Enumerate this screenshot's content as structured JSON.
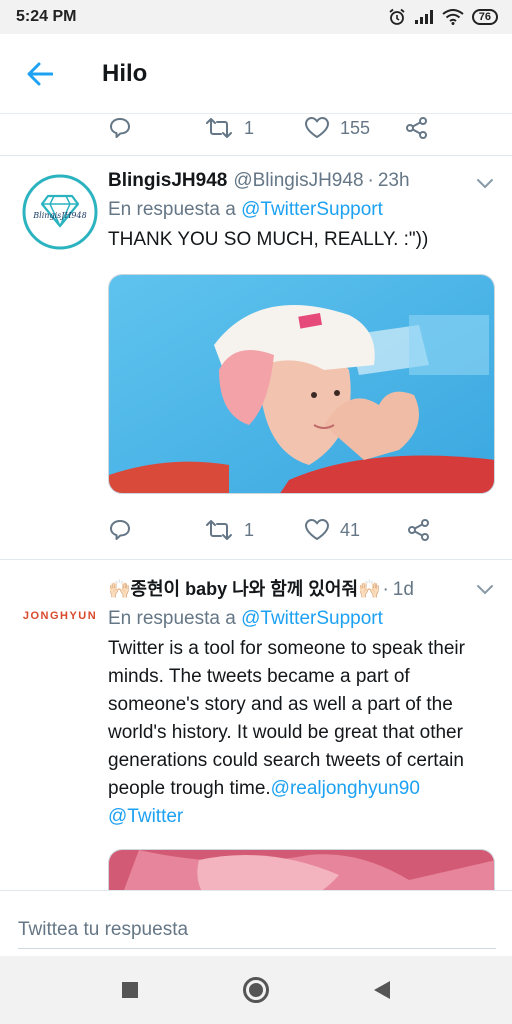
{
  "status_bar": {
    "time": "5:24 PM",
    "battery": "76"
  },
  "header": {
    "title": "Hilo"
  },
  "prev_tweet_actions": {
    "retweets": "1",
    "likes": "155"
  },
  "tweets": [
    {
      "name": "BlingisJH948",
      "handle": "@BlingisJH948",
      "time": "23h",
      "reply_prefix": "En respuesta a",
      "reply_to": "@TwitterSupport",
      "text": "THANK YOU SO MUCH, REALLY. :\"))",
      "avatar_text": "BlingisJH948",
      "retweets": "1",
      "likes": "41"
    },
    {
      "name": "🙌🏻종현이 baby 나와 함께 있어줘🙌🏻",
      "time": "1d",
      "reply_prefix": "En respuesta a",
      "reply_to": "@TwitterSupport",
      "text": "Twitter is a tool for someone to speak their minds. The tweets became a part of someone's story and as well a part of the world's history. It would be great that other generations could search tweets of certain people trough time.",
      "link1": "@realjonghyun90",
      "link2": "@Twitter",
      "avatar_text": "JONGHYUN"
    }
  ],
  "reply_bar": {
    "placeholder": "Twittea tu respuesta"
  },
  "colors": {
    "accent": "#1da1f2",
    "secondary_text": "#657786",
    "logo_red": "#d9482b",
    "diamond_teal": "#2bb3c0"
  }
}
